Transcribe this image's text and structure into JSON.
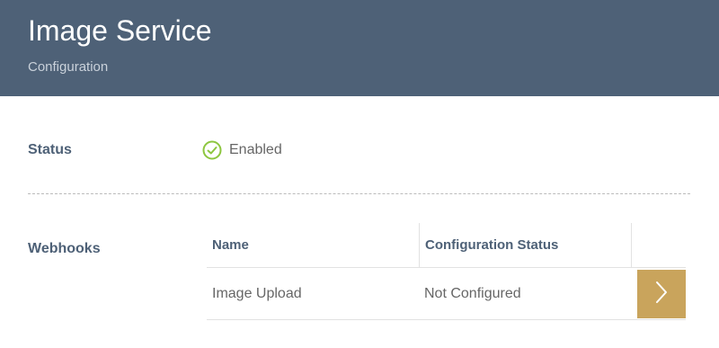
{
  "header": {
    "title": "Image Service",
    "subtitle": "Configuration",
    "background": "#4e6177"
  },
  "status": {
    "label": "Status",
    "value": "Enabled",
    "icon": "check-circle-icon",
    "icon_color": "#8dc63f"
  },
  "webhooks": {
    "label": "Webhooks",
    "columns": [
      "Name",
      "Configuration Status",
      ""
    ],
    "rows": [
      {
        "name": "Image Upload",
        "configuration_status": "Not Configured",
        "action_icon": "chevron-right-icon"
      }
    ],
    "action_color": "#c9a45c"
  }
}
